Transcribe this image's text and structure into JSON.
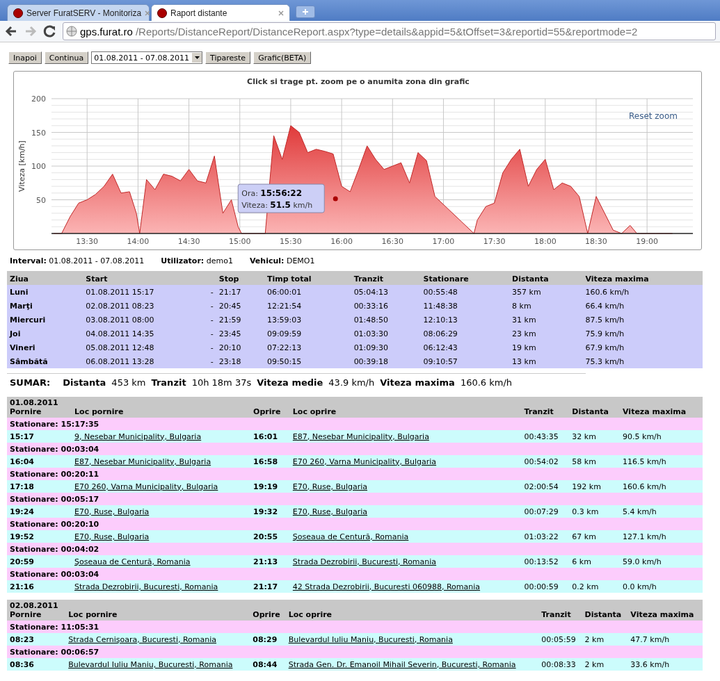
{
  "browser": {
    "tabs": [
      {
        "title": "Server FuratSERV - Monitoriza",
        "selected": false
      },
      {
        "title": "Raport distante",
        "selected": true
      }
    ],
    "url_host": "gps.furat.ro",
    "url_path": "/Reports/DistanceReport/DistanceReport.aspx?type=details&appid=5&tOffset=3&reportid=55&reportmode=2"
  },
  "toolbar": {
    "back_button": "Inapoi",
    "continue_button": "Continua",
    "interval_select": "01.08.2011 - 07.08.2011",
    "print_button": "Tipareste",
    "chart_button": "Grafic(BETA)"
  },
  "chart": {
    "reset_zoom": "Reset zoom",
    "tooltip": {
      "time_label": "Ora:",
      "time": "15:56:22",
      "speed_label": "Viteza:",
      "speed": "51.5",
      "unit": "km/h"
    },
    "chart_data": {
      "type": "area",
      "grid": true,
      "title": "Click si trage pt. zoom pe o anumita zona din grafic",
      "ylabel": "Viteza [km/h]",
      "x": [
        790,
        795,
        800,
        805,
        810,
        815,
        820,
        825,
        830,
        835,
        839,
        841,
        845,
        850,
        855,
        860,
        865,
        870,
        875,
        880,
        885,
        890,
        895,
        899,
        901,
        905,
        910,
        915,
        920,
        925,
        930,
        935,
        940,
        945,
        950,
        955,
        960,
        965,
        970,
        975,
        980,
        985,
        990,
        995,
        1000,
        1005,
        1010,
        1015,
        1038,
        1040,
        1045,
        1050,
        1055,
        1060,
        1065,
        1070,
        1075,
        1080,
        1085,
        1090,
        1095,
        1100,
        1105,
        1110,
        1115,
        1120,
        1125,
        1130,
        1134,
        1136,
        1140,
        1145,
        1150,
        1155
      ],
      "series": [
        {
          "color": "#e03a3a",
          "values": [
            0,
            0,
            25,
            45,
            50,
            58,
            70,
            88,
            60,
            62,
            30,
            0,
            80,
            65,
            88,
            85,
            78,
            95,
            78,
            75,
            115,
            30,
            50,
            10,
            0,
            0,
            0,
            0,
            145,
            110,
            160,
            150,
            120,
            125,
            122,
            118,
            70,
            62,
            95,
            130,
            110,
            95,
            100,
            105,
            75,
            120,
            108,
            55,
            0,
            20,
            40,
            45,
            90,
            110,
            125,
            70,
            95,
            110,
            65,
            75,
            70,
            55,
            0,
            55,
            30,
            5,
            0,
            12,
            0,
            0,
            0,
            0,
            0,
            0
          ]
        }
      ],
      "xlim": [
        789,
        1167
      ],
      "ylim": [
        0,
        200
      ],
      "xticks": [
        {
          "value": 810,
          "label": "13:30"
        },
        {
          "value": 840,
          "label": "14:00"
        },
        {
          "value": 870,
          "label": "14:30"
        },
        {
          "value": 900,
          "label": "15:00"
        },
        {
          "value": 930,
          "label": "15:30"
        },
        {
          "value": 960,
          "label": "16:00"
        },
        {
          "value": 990,
          "label": "16:30"
        },
        {
          "value": 1020,
          "label": "17:00"
        },
        {
          "value": 1050,
          "label": "17:30"
        },
        {
          "value": 1080,
          "label": "18:00"
        },
        {
          "value": 1110,
          "label": "18:30"
        },
        {
          "value": 1140,
          "label": "19:00"
        }
      ],
      "yticks": [
        50,
        100,
        150,
        200
      ]
    }
  },
  "info": [
    {
      "label": "Interval:",
      "value": "01.08.2011 - 07.08.2011"
    },
    {
      "label": "Utilizator:",
      "value": "demo1"
    },
    {
      "label": "Vehicul:",
      "value": "DEMO1"
    }
  ],
  "summary_table": {
    "columns": [
      "Ziua",
      "Start",
      "Stop",
      "Timp total",
      "Tranzit",
      "Stationare",
      "Distanta",
      "Viteza maxima"
    ],
    "rows": [
      {
        "day": "Luni",
        "start": "01.08.2011 15:17",
        "dash": "-",
        "stop": "21:17",
        "total": "06:00:01",
        "transit": "05:04:13",
        "stationary": "00:55:48",
        "distance": "357 km",
        "max_speed": "160.6 km/h"
      },
      {
        "day": "Marţi",
        "start": "02.08.2011 08:23",
        "dash": "-",
        "stop": "20:45",
        "total": "12:21:54",
        "transit": "00:33:16",
        "stationary": "11:48:38",
        "distance": "8 km",
        "max_speed": "66.4 km/h"
      },
      {
        "day": "Miercuri",
        "start": "03.08.2011 08:00",
        "dash": "-",
        "stop": "21:59",
        "total": "13:59:03",
        "transit": "01:48:50",
        "stationary": "12:10:13",
        "distance": "31 km",
        "max_speed": "87.5 km/h"
      },
      {
        "day": "Joi",
        "start": "04.08.2011 14:35",
        "dash": "-",
        "stop": "23:45",
        "total": "09:09:59",
        "transit": "01:03:30",
        "stationary": "08:06:29",
        "distance": "23 km",
        "max_speed": "75.9 km/h"
      },
      {
        "day": "Vineri",
        "start": "05.08.2011 12:48",
        "dash": "-",
        "stop": "20:10",
        "total": "07:22:13",
        "transit": "01:09:30",
        "stationary": "06:12:43",
        "distance": "19 km",
        "max_speed": "67.9 km/h"
      },
      {
        "day": "Sâmbătă",
        "start": "06.08.2011 13:28",
        "dash": "-",
        "stop": "23:18",
        "total": "09:50:15",
        "transit": "00:39:18",
        "stationary": "09:10:57",
        "distance": "13 km",
        "max_speed": "75.3 km/h"
      }
    ]
  },
  "summary": {
    "title": "SUMAR:",
    "items": [
      {
        "label": "Distanta",
        "value": "453 km"
      },
      {
        "label": "Tranzit",
        "value": "10h 18m 37s"
      },
      {
        "label": "Viteza medie",
        "value": "43.9 km/h"
      },
      {
        "label": "Viteza maxima",
        "value": "160.6 km/h"
      }
    ]
  },
  "days": [
    {
      "date": "01.08.2011",
      "columns": [
        "Pornire",
        "Loc pornire",
        "Oprire",
        "Loc oprire",
        "Tranzit",
        "Distanta",
        "Viteza maxima"
      ],
      "rows": [
        {
          "kind": "stop",
          "text": "Stationare: 15:17:35"
        },
        {
          "kind": "trip",
          "start": "15:17",
          "from": "9, Nesebar Municipality, Bulgaria",
          "end": "16:01",
          "to": "E87, Nesebar Municipality, Bulgaria",
          "transit": "00:43:35",
          "distance": "32 km",
          "max_speed": "90.5 km/h"
        },
        {
          "kind": "stop",
          "text": "Stationare: 00:03:04"
        },
        {
          "kind": "trip",
          "start": "16:04",
          "from": "E87, Nesebar Municipality, Bulgaria",
          "end": "16:58",
          "to": "E70 260, Varna Municipality, Bulgaria",
          "transit": "00:54:02",
          "distance": "58 km",
          "max_speed": "116.5 km/h"
        },
        {
          "kind": "stop",
          "text": "Stationare: 00:20:11"
        },
        {
          "kind": "trip",
          "start": "17:18",
          "from": "E70 260, Varna Municipality, Bulgaria",
          "end": "19:19",
          "to": "E70, Ruse, Bulgaria",
          "transit": "02:00:54",
          "distance": "192 km",
          "max_speed": "160.6 km/h"
        },
        {
          "kind": "stop",
          "text": "Stationare: 00:05:17"
        },
        {
          "kind": "trip",
          "start": "19:24",
          "from": "E70, Ruse, Bulgaria",
          "end": "19:32",
          "to": "E70, Ruse, Bulgaria",
          "transit": "00:07:29",
          "distance": "0.3 km",
          "max_speed": "5.4 km/h"
        },
        {
          "kind": "stop",
          "text": "Stationare: 00:20:10"
        },
        {
          "kind": "trip",
          "start": "19:52",
          "from": "E70, Ruse, Bulgaria",
          "end": "20:55",
          "to": "Şoseaua de Centură, Romania",
          "transit": "01:03:22",
          "distance": "67 km",
          "max_speed": "127.1 km/h"
        },
        {
          "kind": "stop",
          "text": "Stationare: 00:04:02"
        },
        {
          "kind": "trip",
          "start": "20:59",
          "from": "Şoseaua de Centură, Romania",
          "end": "21:13",
          "to": "Strada Dezrobirii, Bucuresti, Romania",
          "transit": "00:13:52",
          "distance": "6 km",
          "max_speed": "59.0 km/h"
        },
        {
          "kind": "stop",
          "text": "Stationare: 00:03:04"
        },
        {
          "kind": "trip",
          "start": "21:16",
          "from": "Strada Dezrobirii, Bucuresti, Romania",
          "end": "21:17",
          "to": "42 Strada Dezrobirii, Bucuresti 060988, Romania",
          "transit": "00:00:59",
          "distance": "0.2 km",
          "max_speed": "0.0 km/h"
        }
      ]
    },
    {
      "date": "02.08.2011",
      "columns": [
        "Pornire",
        "Loc pornire",
        "Oprire",
        "Loc oprire",
        "Tranzit",
        "Distanta",
        "Viteza maxima"
      ],
      "rows": [
        {
          "kind": "stop",
          "text": "Stationare: 11:05:31"
        },
        {
          "kind": "trip",
          "start": "08:23",
          "from": "Strada Cernişoara, Bucuresti, Romania",
          "end": "08:29",
          "to": "Bulevardul Iuliu Maniu, Bucuresti, Romania",
          "transit": "00:05:59",
          "distance": "2 km",
          "max_speed": "47.7 km/h"
        },
        {
          "kind": "stop",
          "text": "Stationare: 00:06:57"
        },
        {
          "kind": "trip",
          "start": "08:36",
          "from": "Bulevardul Iuliu Maniu, Bucuresti, Romania",
          "end": "08:44",
          "to": "Strada Gen. Dr. Emanoil Mihail Severin, Bucuresti, Romania",
          "transit": "00:08:33",
          "distance": "2 km",
          "max_speed": "33.6 km/h"
        }
      ]
    }
  ]
}
